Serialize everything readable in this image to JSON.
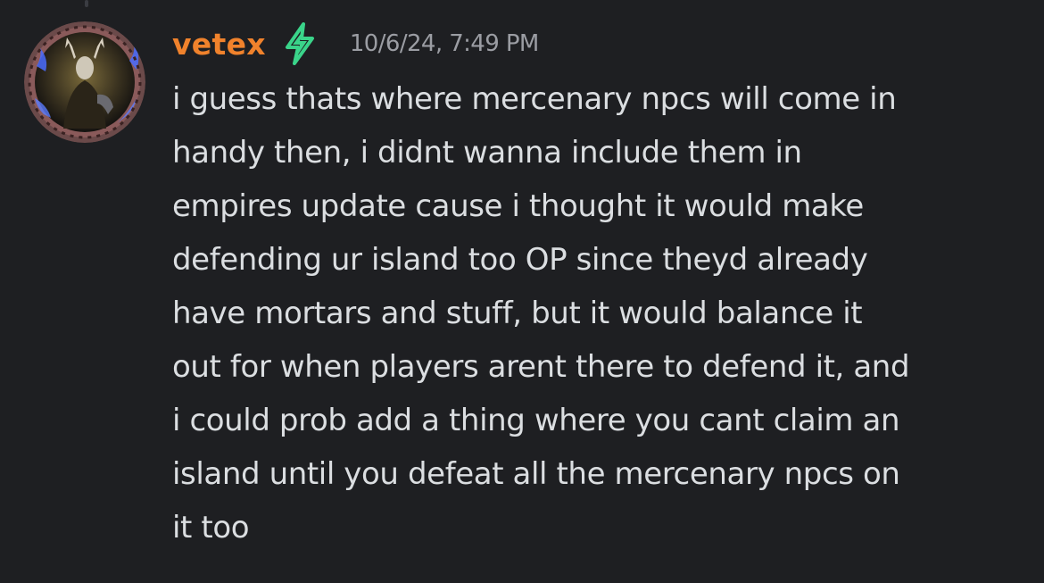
{
  "message": {
    "author": {
      "username": "vetex",
      "username_color": "#f0822c",
      "avatar_icon": "avatar-horned-knight",
      "badge_icon": "lightning-bolt-icon",
      "badge_color": "#3ad48a"
    },
    "timestamp": "10/6/24, 7:49 PM",
    "lines": [
      "i guess thats where mercenary npcs will come in",
      "handy then, i didnt wanna include them in",
      "empires update cause i thought it would make",
      "defending ur island too OP since theyd already",
      "have mortars and stuff, but it would balance it",
      "out for when players arent there to defend it, and",
      "i could prob add a thing where you cant claim an",
      "island until you defeat all the mercenary npcs on",
      "it too"
    ]
  },
  "theme": {
    "background": "#1e1f22",
    "text": "#dbdee1",
    "muted": "#9b9da3"
  }
}
